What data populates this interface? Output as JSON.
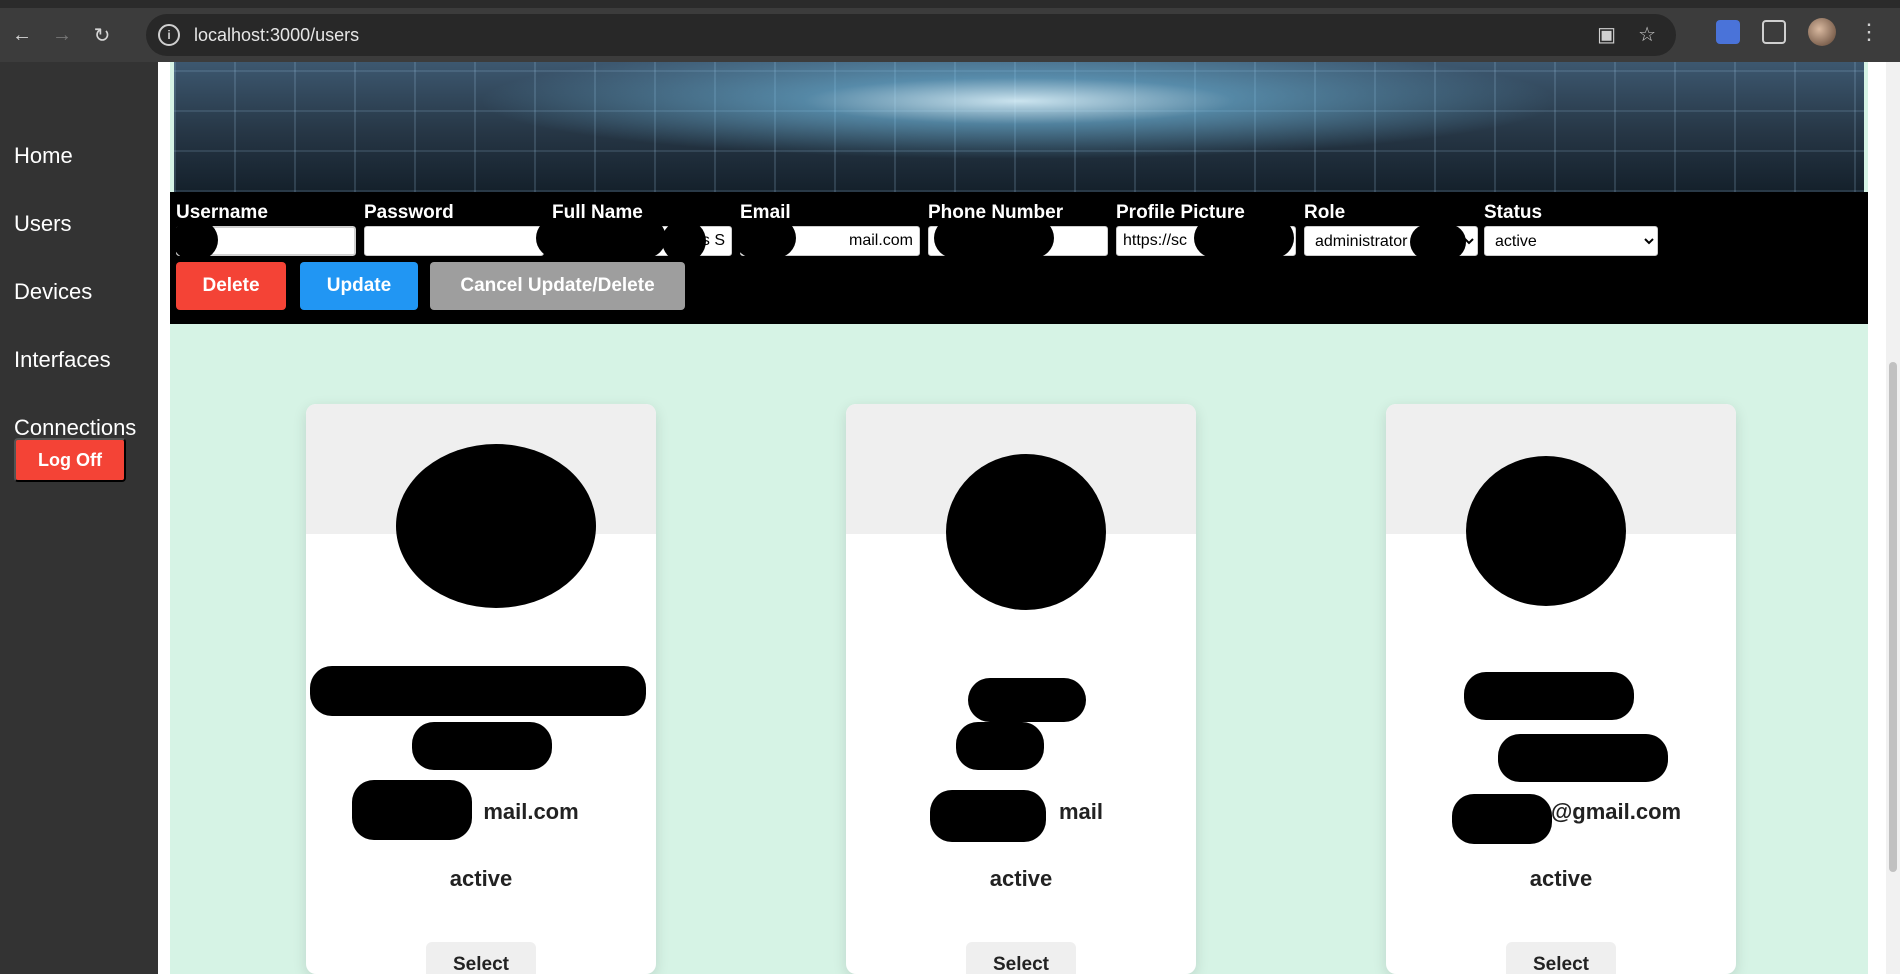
{
  "browser": {
    "url": "localhost:3000/users",
    "back_icon": "arrow-left-icon",
    "forward_icon": "arrow-right-icon",
    "reload_icon": "reload-icon"
  },
  "sidebar": {
    "items": [
      {
        "label": "Home"
      },
      {
        "label": "Users"
      },
      {
        "label": "Devices"
      },
      {
        "label": "Interfaces"
      },
      {
        "label": "Connections"
      }
    ],
    "logoff_label": "Log Off"
  },
  "form": {
    "username_label": "Username",
    "password_label": "Password",
    "fullname_label": "Full Name",
    "email_label": "Email",
    "phone_label": "Phone Number",
    "picture_label": "Profile Picture",
    "role_label": "Role",
    "status_label": "Status",
    "username_value": "",
    "password_value": "",
    "fullname_value": "es S",
    "email_value": "mail.com",
    "phone_value": "",
    "picture_value": "https://sc",
    "role_value": "administrator",
    "status_value": "active",
    "delete_label": "Delete",
    "update_label": "Update",
    "cancel_label": "Cancel Update/Delete"
  },
  "cards": [
    {
      "email": "mail.com",
      "status": "active",
      "select_label": "Select"
    },
    {
      "email": "mail",
      "status": "active",
      "select_label": "Select"
    },
    {
      "email": "@gmail.com",
      "status": "active",
      "select_label": "Select"
    }
  ],
  "colors": {
    "delete": "#f44336",
    "update": "#2196f3",
    "cancel": "#9e9e9e",
    "page_bg": "#d6f3e5",
    "sidebar_bg": "#333333"
  }
}
